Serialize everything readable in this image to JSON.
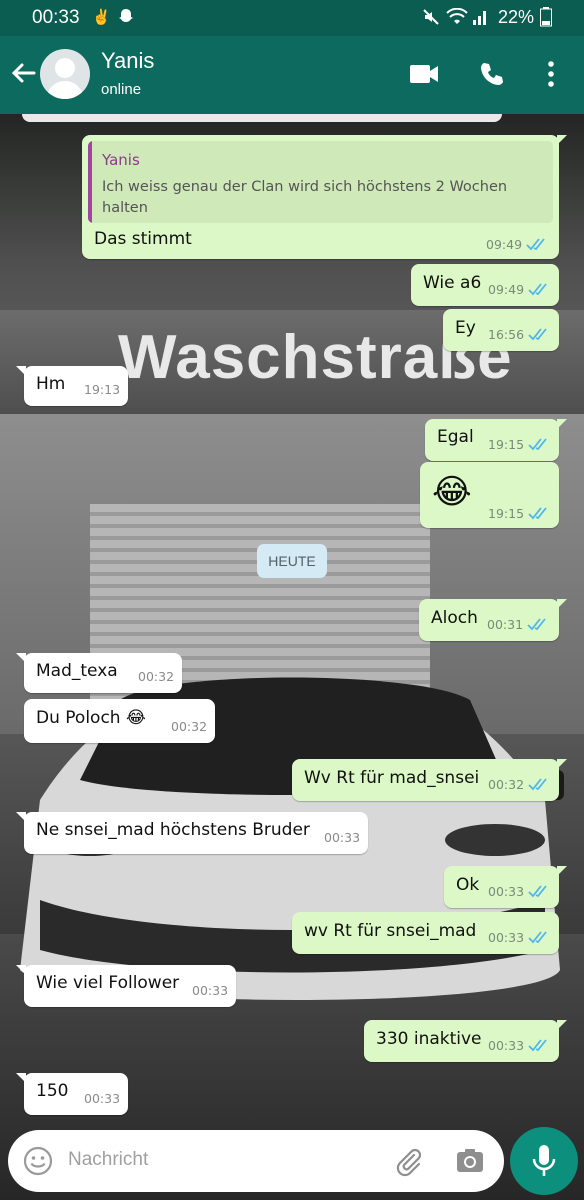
{
  "status_bar": {
    "time": "00:33",
    "battery": "22%",
    "icons": [
      "hand-gesture-icon",
      "snapchat-ghost-icon",
      "mute-icon",
      "wifi-icon",
      "signal-icon",
      "battery-icon"
    ]
  },
  "header": {
    "contact_name": "Yanis",
    "status": "online",
    "icons": [
      "back-arrow-icon",
      "video-call-icon",
      "phone-call-icon",
      "more-options-icon"
    ]
  },
  "background": {
    "sign_text": "Waschstraße"
  },
  "messages": [
    {
      "dir": "out",
      "quote_author": "Yanis",
      "quote_text": "Ich weiss genau der Clan wird sich höchstens 2 Wochen halten",
      "text": "Das stimmt",
      "time": "09:49",
      "read": true
    },
    {
      "dir": "out",
      "text": "Wie a6",
      "time": "09:49",
      "read": true
    },
    {
      "dir": "out",
      "text": "Ey",
      "time": "16:56",
      "read": true
    },
    {
      "dir": "in",
      "text": "Hm",
      "time": "19:13"
    },
    {
      "dir": "out",
      "text": "Egal",
      "time": "19:15",
      "read": true
    },
    {
      "dir": "out",
      "text": "😂",
      "time": "19:15",
      "read": true
    },
    {
      "dir": "date",
      "text": "HEUTE"
    },
    {
      "dir": "out",
      "text": "Aloch",
      "time": "00:31",
      "read": true
    },
    {
      "dir": "in",
      "text": "Mad_texa",
      "time": "00:32"
    },
    {
      "dir": "in",
      "text": "Du Poloch 😂",
      "time": "00:32"
    },
    {
      "dir": "out",
      "text": "Wv Rt für mad_snsei",
      "time": "00:32",
      "read": true
    },
    {
      "dir": "in",
      "text": "Ne snsei_mad höchstens Bruder",
      "time": "00:33"
    },
    {
      "dir": "out",
      "text": "Ok",
      "time": "00:33",
      "read": true
    },
    {
      "dir": "out",
      "text": "wv Rt für snsei_mad",
      "time": "00:33",
      "read": true
    },
    {
      "dir": "in",
      "text": "Wie viel Follower",
      "time": "00:33"
    },
    {
      "dir": "out",
      "text": "330 inaktive",
      "time": "00:33",
      "read": true
    },
    {
      "dir": "in",
      "text": "150",
      "time": "00:33"
    }
  ],
  "composer": {
    "placeholder": "Nachricht",
    "icons": [
      "emoji-icon",
      "attach-icon",
      "camera-icon",
      "mic-icon"
    ]
  },
  "colors": {
    "header": "#0c6b5e",
    "status_bar": "#0b5c51",
    "outgoing_bubble": "#dcf8c6",
    "incoming_bubble": "#ffffff",
    "read_ticks": "#4fb6ec",
    "mic_button": "#0c8f7d"
  }
}
